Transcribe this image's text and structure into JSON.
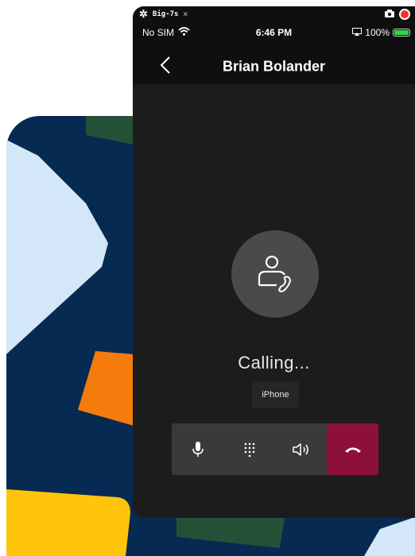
{
  "simulator": {
    "title": "Big-7s",
    "close_glyph": "×"
  },
  "status_bar": {
    "carrier": "No SIM",
    "time": "6:46 PM",
    "battery": "100%"
  },
  "nav": {
    "contact_name": "Brian Bolander"
  },
  "call": {
    "status": "Calling...",
    "device": "iPhone"
  },
  "controls": [
    {
      "name": "microphone",
      "icon": "microphone-icon"
    },
    {
      "name": "dialpad",
      "icon": "dialpad-icon"
    },
    {
      "name": "speaker",
      "icon": "speaker-icon"
    },
    {
      "name": "end-call",
      "icon": "hang-up-icon"
    }
  ],
  "colors": {
    "background_navy": "#072a52",
    "phone_bg": "#1c1c1c",
    "end_call": "#8c0f3c",
    "control_bar": "#3a3a3a",
    "recording_red": "#ff2a2a",
    "battery_green": "#35d14a"
  }
}
